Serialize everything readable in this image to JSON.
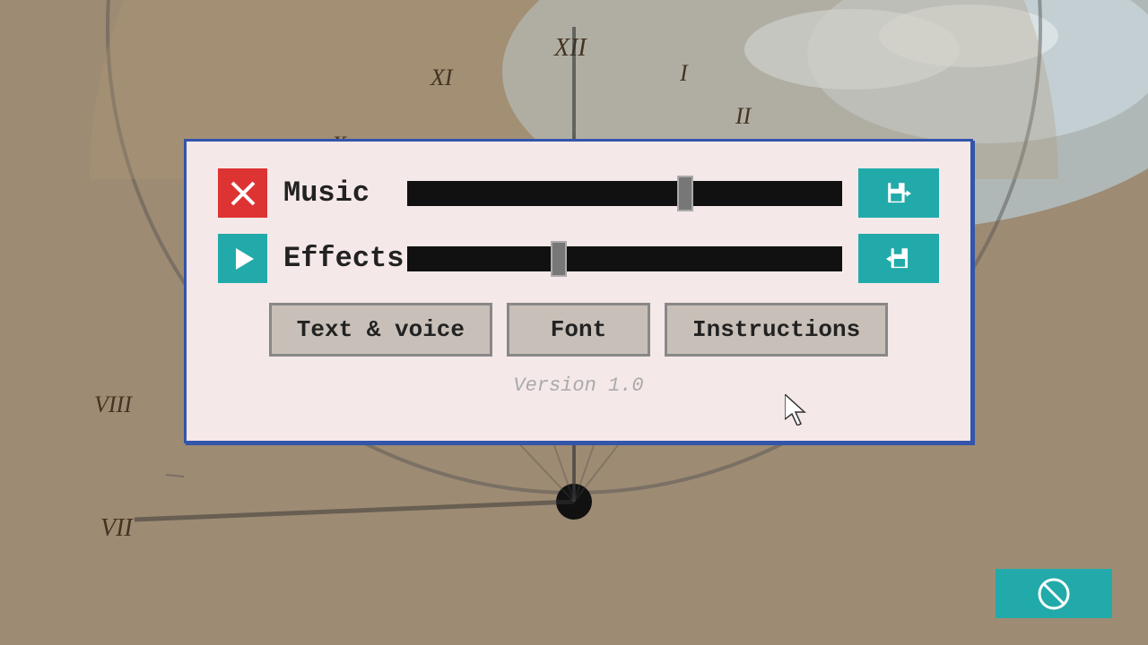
{
  "background": {
    "sky_color": "#b8ccd8",
    "ground_color": "#a08060"
  },
  "dialog": {
    "music_label": "Music",
    "effects_label": "Effects",
    "music_slider_value": 65,
    "effects_slider_value": 35,
    "buttons": {
      "text_voice": "Text & voice",
      "font": "Font",
      "instructions": "Instructions"
    },
    "version": "Version 1.0"
  },
  "icons": {
    "music_off": "x-icon",
    "effects_play": "play-icon",
    "save_forward": "save-forward-icon",
    "load_back": "load-back-icon",
    "corner_no": "no-icon"
  }
}
